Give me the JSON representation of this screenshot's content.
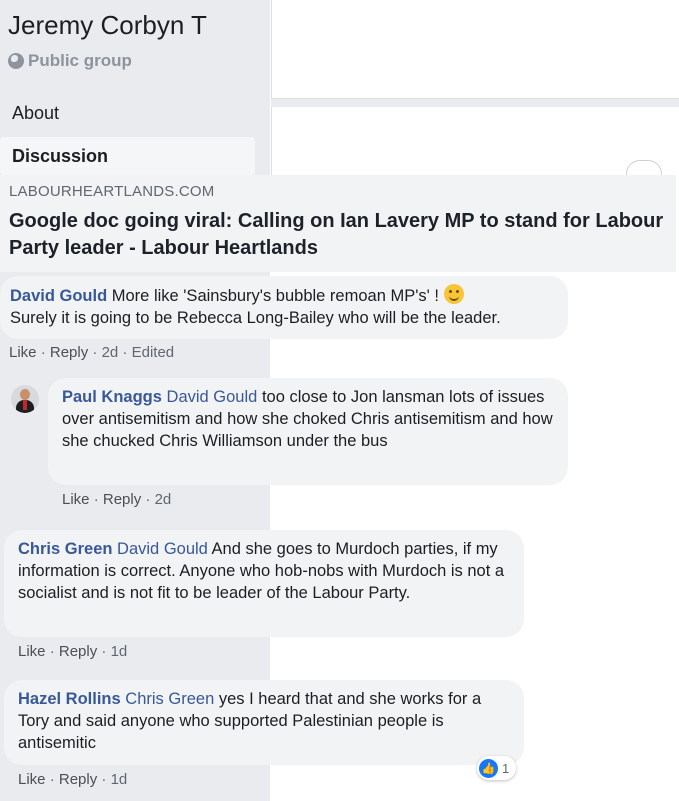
{
  "sidebar": {
    "group_name": "Jeremy Corbyn T",
    "privacy": "Public group",
    "nav": {
      "about": "About",
      "discussion": "Discussion"
    }
  },
  "link_preview": {
    "domain": "LABOURHEARTLANDS.COM",
    "title": "Google doc going viral: Calling on Ian Lavery MP to stand for Labour Party leader - Labour Heartlands"
  },
  "comments": [
    {
      "author": "David Gould",
      "mention": "",
      "text": "More like 'Sainsbury's bubble remoan MP's' !",
      "text2": "Surely it is going to be Rebecca Long-Bailey who will be the leader.",
      "like": "Like",
      "reply": "Reply",
      "time": "2d",
      "edited": "Edited"
    },
    {
      "author": "Paul Knaggs",
      "mention": "David Gould",
      "text": "too close to Jon lansman lots of issues over antisemitism and how she choked Chris antisemitism and how she chucked Chris Williamson under the bus",
      "like": "Like",
      "reply": "Reply",
      "time": "2d"
    },
    {
      "author": "Chris Green",
      "mention": "David Gould",
      "text": "And she goes to Murdoch parties, if my information is correct. Anyone who hob-nobs with Murdoch is not a socialist and is not fit to be leader of the Labour Party.",
      "like": "Like",
      "reply": "Reply",
      "time": "1d"
    },
    {
      "author": "Hazel Rollins",
      "mention": "Chris Green",
      "text": "yes I heard that and she works for a Tory and said anyone who supported Palestinian people is antisemitic",
      "like": "Like",
      "reply": "Reply",
      "time": "1d",
      "reaction_count": "1"
    }
  ],
  "colors": {
    "link": "#385898",
    "bubble": "#f2f3f5",
    "sidebar": "#e9ebee",
    "like_blue": "#1877f2"
  }
}
